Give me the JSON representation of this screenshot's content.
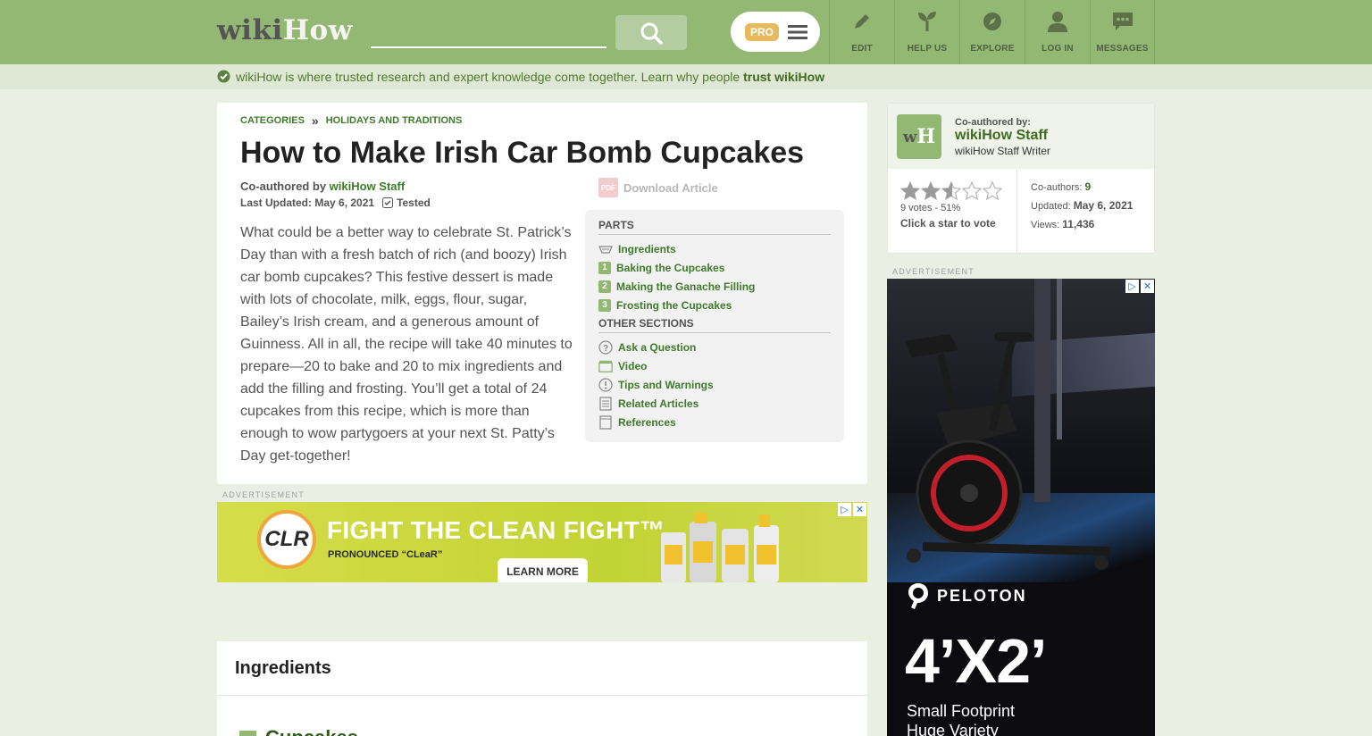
{
  "header": {
    "logo_wiki": "wiki",
    "logo_how": "How",
    "search_placeholder": "",
    "pro_label": "PRO",
    "nav": [
      {
        "label": "EDIT",
        "icon": "pencil-icon"
      },
      {
        "label": "HELP US",
        "icon": "sprout-icon"
      },
      {
        "label": "EXPLORE",
        "icon": "compass-icon"
      },
      {
        "label": "LOG IN",
        "icon": "user-icon"
      },
      {
        "label": "MESSAGES",
        "icon": "chat-icon"
      }
    ]
  },
  "trust": {
    "text": "wikiHow is where trusted research and expert knowledge come together. Learn why people ",
    "link": "trust wikiHow"
  },
  "article": {
    "breadcrumb": [
      "CATEGORIES",
      "HOLIDAYS AND TRADITIONS"
    ],
    "breadcrumb_sep": "»",
    "title": "How to Make Irish Car Bomb Cupcakes",
    "coauthored_prefix": "Co-authored by ",
    "coauthored_name": "wikiHow Staff",
    "last_updated": "Last Updated: May 6, 2021",
    "tested_label": "Tested",
    "intro": "What could be a better way to celebrate St. Patrick’s Day than with a fresh batch of rich (and boozy) Irish car bomb cupcakes? This festive dessert is made with lots of chocolate, milk, eggs, flour, sugar, Bailey’s Irish cream, and a generous amount of Guinness. All in all, the recipe will take 40 minutes to prepare—20 to bake and 20 to mix ingredients and add the filling and frosting. You’ll get a total of 24 cupcakes from this recipe, which is more than enough to wow partygoers at your next St. Patty’s Day get-together!",
    "download_label": "Download Article",
    "pdf_badge": "PDF"
  },
  "toc": {
    "parts_heading": "PARTS",
    "ingredients_label": "Ingredients",
    "parts": [
      {
        "num": "1",
        "label": "Baking the Cupcakes"
      },
      {
        "num": "2",
        "label": "Making the Ganache Filling"
      },
      {
        "num": "3",
        "label": "Frosting the Cupcakes"
      }
    ],
    "other_heading": "OTHER SECTIONS",
    "other": [
      {
        "label": "Ask a Question",
        "icon": "question-icon"
      },
      {
        "label": "Video",
        "icon": "video-icon"
      },
      {
        "label": "Tips and Warnings",
        "icon": "exclamation-icon"
      },
      {
        "label": "Related Articles",
        "icon": "document-icon"
      },
      {
        "label": "References",
        "icon": "page-icon"
      }
    ]
  },
  "ads": {
    "label": "ADVERTISEMENT",
    "banner": {
      "logo": "CLR",
      "headline": "FIGHT THE CLEAN FIGHT™",
      "sub": "PRONOUNCED “CLeaR”",
      "cta": "LEARN MORE"
    },
    "side": {
      "brand": "PELOTON",
      "big": "4’X2’",
      "line1": "Small Footprint",
      "line2": "Huge Variety"
    }
  },
  "ingredients": {
    "heading": "Ingredients",
    "subheading": "Cupcakes"
  },
  "sidebar": {
    "coauthored_label": "Co-authored by:",
    "author_name": "wikiHow Staff",
    "author_role": "wikiHow Staff Writer",
    "avatar_w": "w",
    "avatar_h": "H",
    "rating_fraction": 0.51,
    "votes": "9 votes - 51%",
    "vote_cta": "Click a star to vote",
    "coauthors_label": "Co-authors: ",
    "coauthors_value": "9",
    "updated_label": "Updated: ",
    "updated_value": "May 6, 2021",
    "views_label": "Views: ",
    "views_value": "11,436"
  },
  "colors": {
    "brand_green": "#93b874",
    "link_green": "#3f7a2a"
  }
}
